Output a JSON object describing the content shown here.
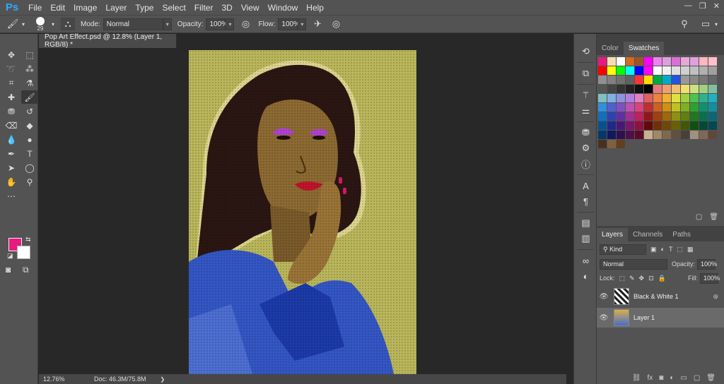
{
  "app": {
    "logo": "Ps"
  },
  "menu": [
    "File",
    "Edit",
    "Image",
    "Layer",
    "Type",
    "Select",
    "Filter",
    "3D",
    "View",
    "Window",
    "Help"
  ],
  "options": {
    "brush_size": "29",
    "mode_label": "Mode:",
    "mode_value": "Normal",
    "opacity_label": "Opacity:",
    "opacity_value": "100%",
    "flow_label": "Flow:",
    "flow_value": "100%"
  },
  "document": {
    "tab_title": "Pop Art Effect.psd @ 12.8% (Layer 1, RGB/8) *",
    "zoom": "12.76%",
    "doc_info": "Doc: 46.3M/75.8M"
  },
  "colors": {
    "foreground": "#e8197f",
    "background": "#ffffff"
  },
  "color_panel": {
    "tabs": [
      "Color",
      "Swatches"
    ],
    "swatches": [
      "#e8197f",
      "#f5deb3",
      "#ffffff",
      "#d2691e",
      "#a0522d",
      "#ff00ff",
      "#ee82ee",
      "#dda0dd",
      "#da70d6",
      "#e6a8d7",
      "#dfa0e0",
      "#ffb6c1",
      "#ffc0cb",
      "#ff0000",
      "#ffff00",
      "#00ff00",
      "#00ffff",
      "#0000ff",
      "#ff00ff",
      "#ffffff",
      "#f0f0f0",
      "#e0e0e0",
      "#d0d0d0",
      "#c0c0c0",
      "#b0b0b0",
      "#a0a0a0",
      "#909090",
      "#808080",
      "#707070",
      "#606060",
      "#ff3333",
      "#ffdd00",
      "#00aa44",
      "#00aacc",
      "#2255dd",
      "#999999",
      "#888888",
      "#777777",
      "#666666",
      "#555555",
      "#444444",
      "#333333",
      "#222222",
      "#111111",
      "#000000",
      "#e87a7a",
      "#f0a070",
      "#f0c070",
      "#f0e070",
      "#d0e080",
      "#a0d080",
      "#80c0a0",
      "#80c0c0",
      "#80b0e0",
      "#9090e0",
      "#b080e0",
      "#e080c0",
      "#e06060",
      "#ef8040",
      "#f0b030",
      "#e0e040",
      "#a0d040",
      "#50c050",
      "#30b090",
      "#20b0c0",
      "#3090e0",
      "#5060d0",
      "#8050c0",
      "#c050b0",
      "#e04080",
      "#c03030",
      "#d06020",
      "#d09010",
      "#c0c020",
      "#80b020",
      "#30a030",
      "#109070",
      "#1090a0",
      "#1070c0",
      "#3040b0",
      "#6030a0",
      "#a03090",
      "#c02060",
      "#901818",
      "#a04010",
      "#a06808",
      "#909010",
      "#608010",
      "#207820",
      "#087050",
      "#086878",
      "#085090",
      "#202888",
      "#481878",
      "#781868",
      "#901040",
      "#600a0a",
      "#703008",
      "#704808",
      "#686008",
      "#405808",
      "#105010",
      "#054838",
      "#054850",
      "#053868",
      "#101860",
      "#300f50",
      "#500f48",
      "#600828",
      "#c8b090",
      "#a08868",
      "#806850",
      "#605040",
      "#484038",
      "#a09080",
      "#806858",
      "#604838",
      "#483020",
      "#806040",
      "#604020"
    ],
    "labels": {
      "rec_labels": []
    }
  },
  "layers_panel": {
    "tabs": [
      "Layers",
      "Channels",
      "Paths"
    ],
    "filter": "Kind",
    "blend": "Normal",
    "opacity_label": "Opacity:",
    "opacity_value": "100%",
    "lock_label": "Lock:",
    "fill_label": "Fill:",
    "fill_value": "100%",
    "layers": [
      {
        "name": "Black & White 1"
      },
      {
        "name": "Layer 1"
      }
    ]
  }
}
